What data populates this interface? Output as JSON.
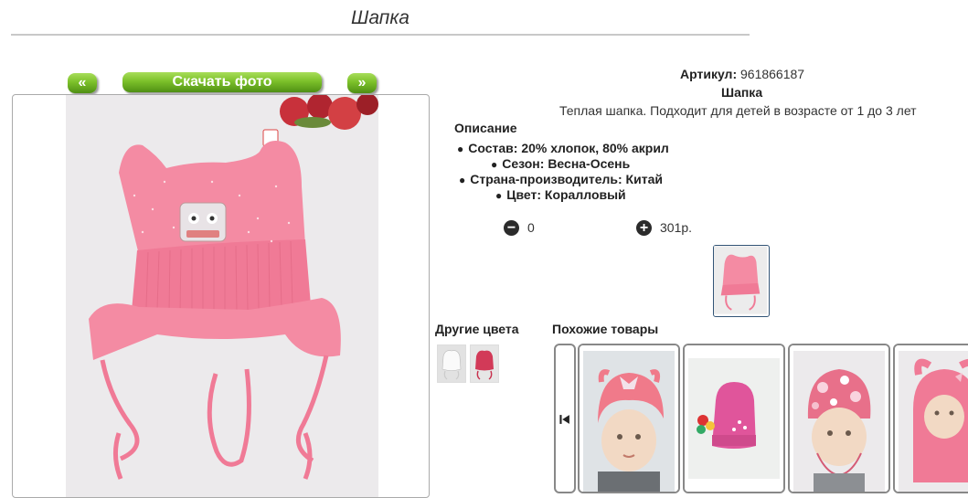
{
  "page": {
    "title": "Шапка"
  },
  "photo_nav": {
    "prev_label": "«",
    "download_label": "Скачать фото",
    "next_label": "»"
  },
  "product": {
    "sku_label": "Артикул:",
    "sku_value": "961866187",
    "name": "Шапка",
    "short_description": "Теплая шапка. Подходит для детей в возрасте от 1 до 3 лет",
    "description_heading": "Описание",
    "attributes": [
      "Состав: 20% хлопок, 80% акрил",
      "Сезон: Весна-Осень",
      "Страна-производитель: Китай",
      "Цвет: Коралловый"
    ]
  },
  "cart": {
    "minus_icon": "minus-circle-icon",
    "quantity": "0",
    "plus_icon": "plus-circle-icon",
    "price": "301р."
  },
  "other_colors": {
    "heading": "Другие цвета"
  },
  "similar": {
    "heading": "Похожие товары",
    "prev_icon": "skip-back-icon"
  },
  "colors": {
    "accent_green": "#7cc12a",
    "hat_pink": "#f7809a"
  }
}
